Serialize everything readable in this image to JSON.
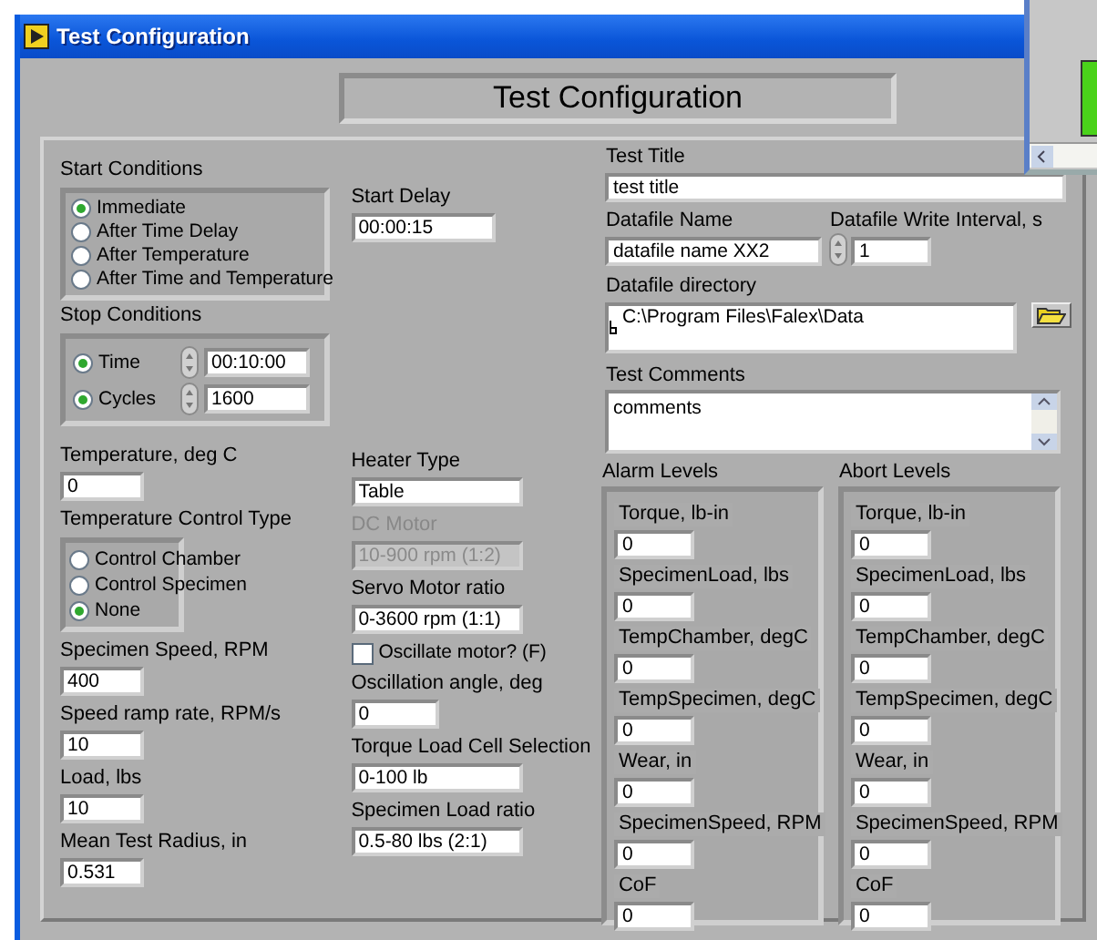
{
  "window": {
    "title": "Test Configuration"
  },
  "heading": "Test Configuration",
  "start_conditions": {
    "label": "Start Conditions",
    "options": [
      {
        "label": "Immediate",
        "selected": true
      },
      {
        "label": "After Time Delay",
        "selected": false
      },
      {
        "label": "After Temperature",
        "selected": false
      },
      {
        "label": "After Time and Temperature",
        "selected": false
      }
    ]
  },
  "start_delay": {
    "label": "Start Delay",
    "value": "00:00:15"
  },
  "stop_conditions": {
    "label": "Stop Conditions",
    "options": [
      {
        "label": "Time",
        "selected": true,
        "value": "00:10:00"
      },
      {
        "label": "Cycles",
        "selected": true,
        "value": "1600"
      }
    ]
  },
  "left_controls": [
    {
      "kind": "field",
      "label": "Temperature, deg C",
      "value": "0"
    },
    {
      "kind": "radio",
      "label": "Temperature Control Type",
      "options": [
        {
          "label": "Control Chamber",
          "selected": false
        },
        {
          "label": "Control Specimen",
          "selected": false
        },
        {
          "label": "None",
          "selected": true
        }
      ]
    },
    {
      "kind": "field",
      "label": "Specimen Speed, RPM",
      "value": "400"
    },
    {
      "kind": "field",
      "label": "Speed ramp rate, RPM/s",
      "value": "10"
    },
    {
      "kind": "field",
      "label": "Load, lbs",
      "value": "10"
    },
    {
      "kind": "field",
      "label": "Mean Test Radius, in",
      "value": "0.531"
    }
  ],
  "middle_controls": [
    {
      "kind": "field",
      "label": "Heater Type",
      "value": "Table",
      "disabled": false
    },
    {
      "kind": "field",
      "label": "DC Motor",
      "value": "10-900 rpm (1:2)",
      "disabled": true
    },
    {
      "kind": "field",
      "label": "Servo Motor ratio",
      "value": "0-3600 rpm (1:1)",
      "disabled": false
    },
    {
      "kind": "checkbox",
      "label": "Oscillate motor? (F)",
      "checked": false,
      "disabled": false
    },
    {
      "kind": "field",
      "label": "Oscillation angle, deg",
      "value": "0",
      "disabled": false
    },
    {
      "kind": "field",
      "label": "Torque Load Cell Selection",
      "value": "0-100 lb",
      "disabled": false
    },
    {
      "kind": "field",
      "label": "Specimen Load ratio",
      "value": "0.5-80 lbs (2:1)",
      "disabled": false
    }
  ],
  "test_title": {
    "label": "Test Title",
    "value": "test title"
  },
  "datafile_name": {
    "label": "Datafile Name",
    "value": "datafile name XX2"
  },
  "datafile_write_interval": {
    "label": "Datafile Write Interval, s",
    "value": "1"
  },
  "datafile_directory": {
    "label": "Datafile directory",
    "value": "C:\\Program Files\\Falex\\Data"
  },
  "test_comments": {
    "label": "Test Comments",
    "value": "comments"
  },
  "alarm_levels": {
    "label": "Alarm Levels",
    "items": [
      {
        "label": "Torque, lb-in",
        "value": "0"
      },
      {
        "label": "SpecimenLoad, lbs",
        "value": "0"
      },
      {
        "label": "TempChamber, degC",
        "value": "0"
      },
      {
        "label": "TempSpecimen, degC",
        "value": "0"
      },
      {
        "label": "Wear, in",
        "value": "0"
      },
      {
        "label": "SpecimenSpeed, RPM",
        "value": "0"
      },
      {
        "label": "CoF",
        "value": "0"
      }
    ]
  },
  "abort_levels": {
    "label": "Abort Levels",
    "items": [
      {
        "label": "Torque, lb-in",
        "value": "0"
      },
      {
        "label": "SpecimenLoad, lbs",
        "value": "0"
      },
      {
        "label": "TempChamber, degC",
        "value": "0"
      },
      {
        "label": "TempSpecimen, degC",
        "value": "0"
      },
      {
        "label": "Wear, in",
        "value": "0"
      },
      {
        "label": "SpecimenSpeed, RPM",
        "value": "0"
      },
      {
        "label": "CoF",
        "value": "0"
      }
    ]
  }
}
